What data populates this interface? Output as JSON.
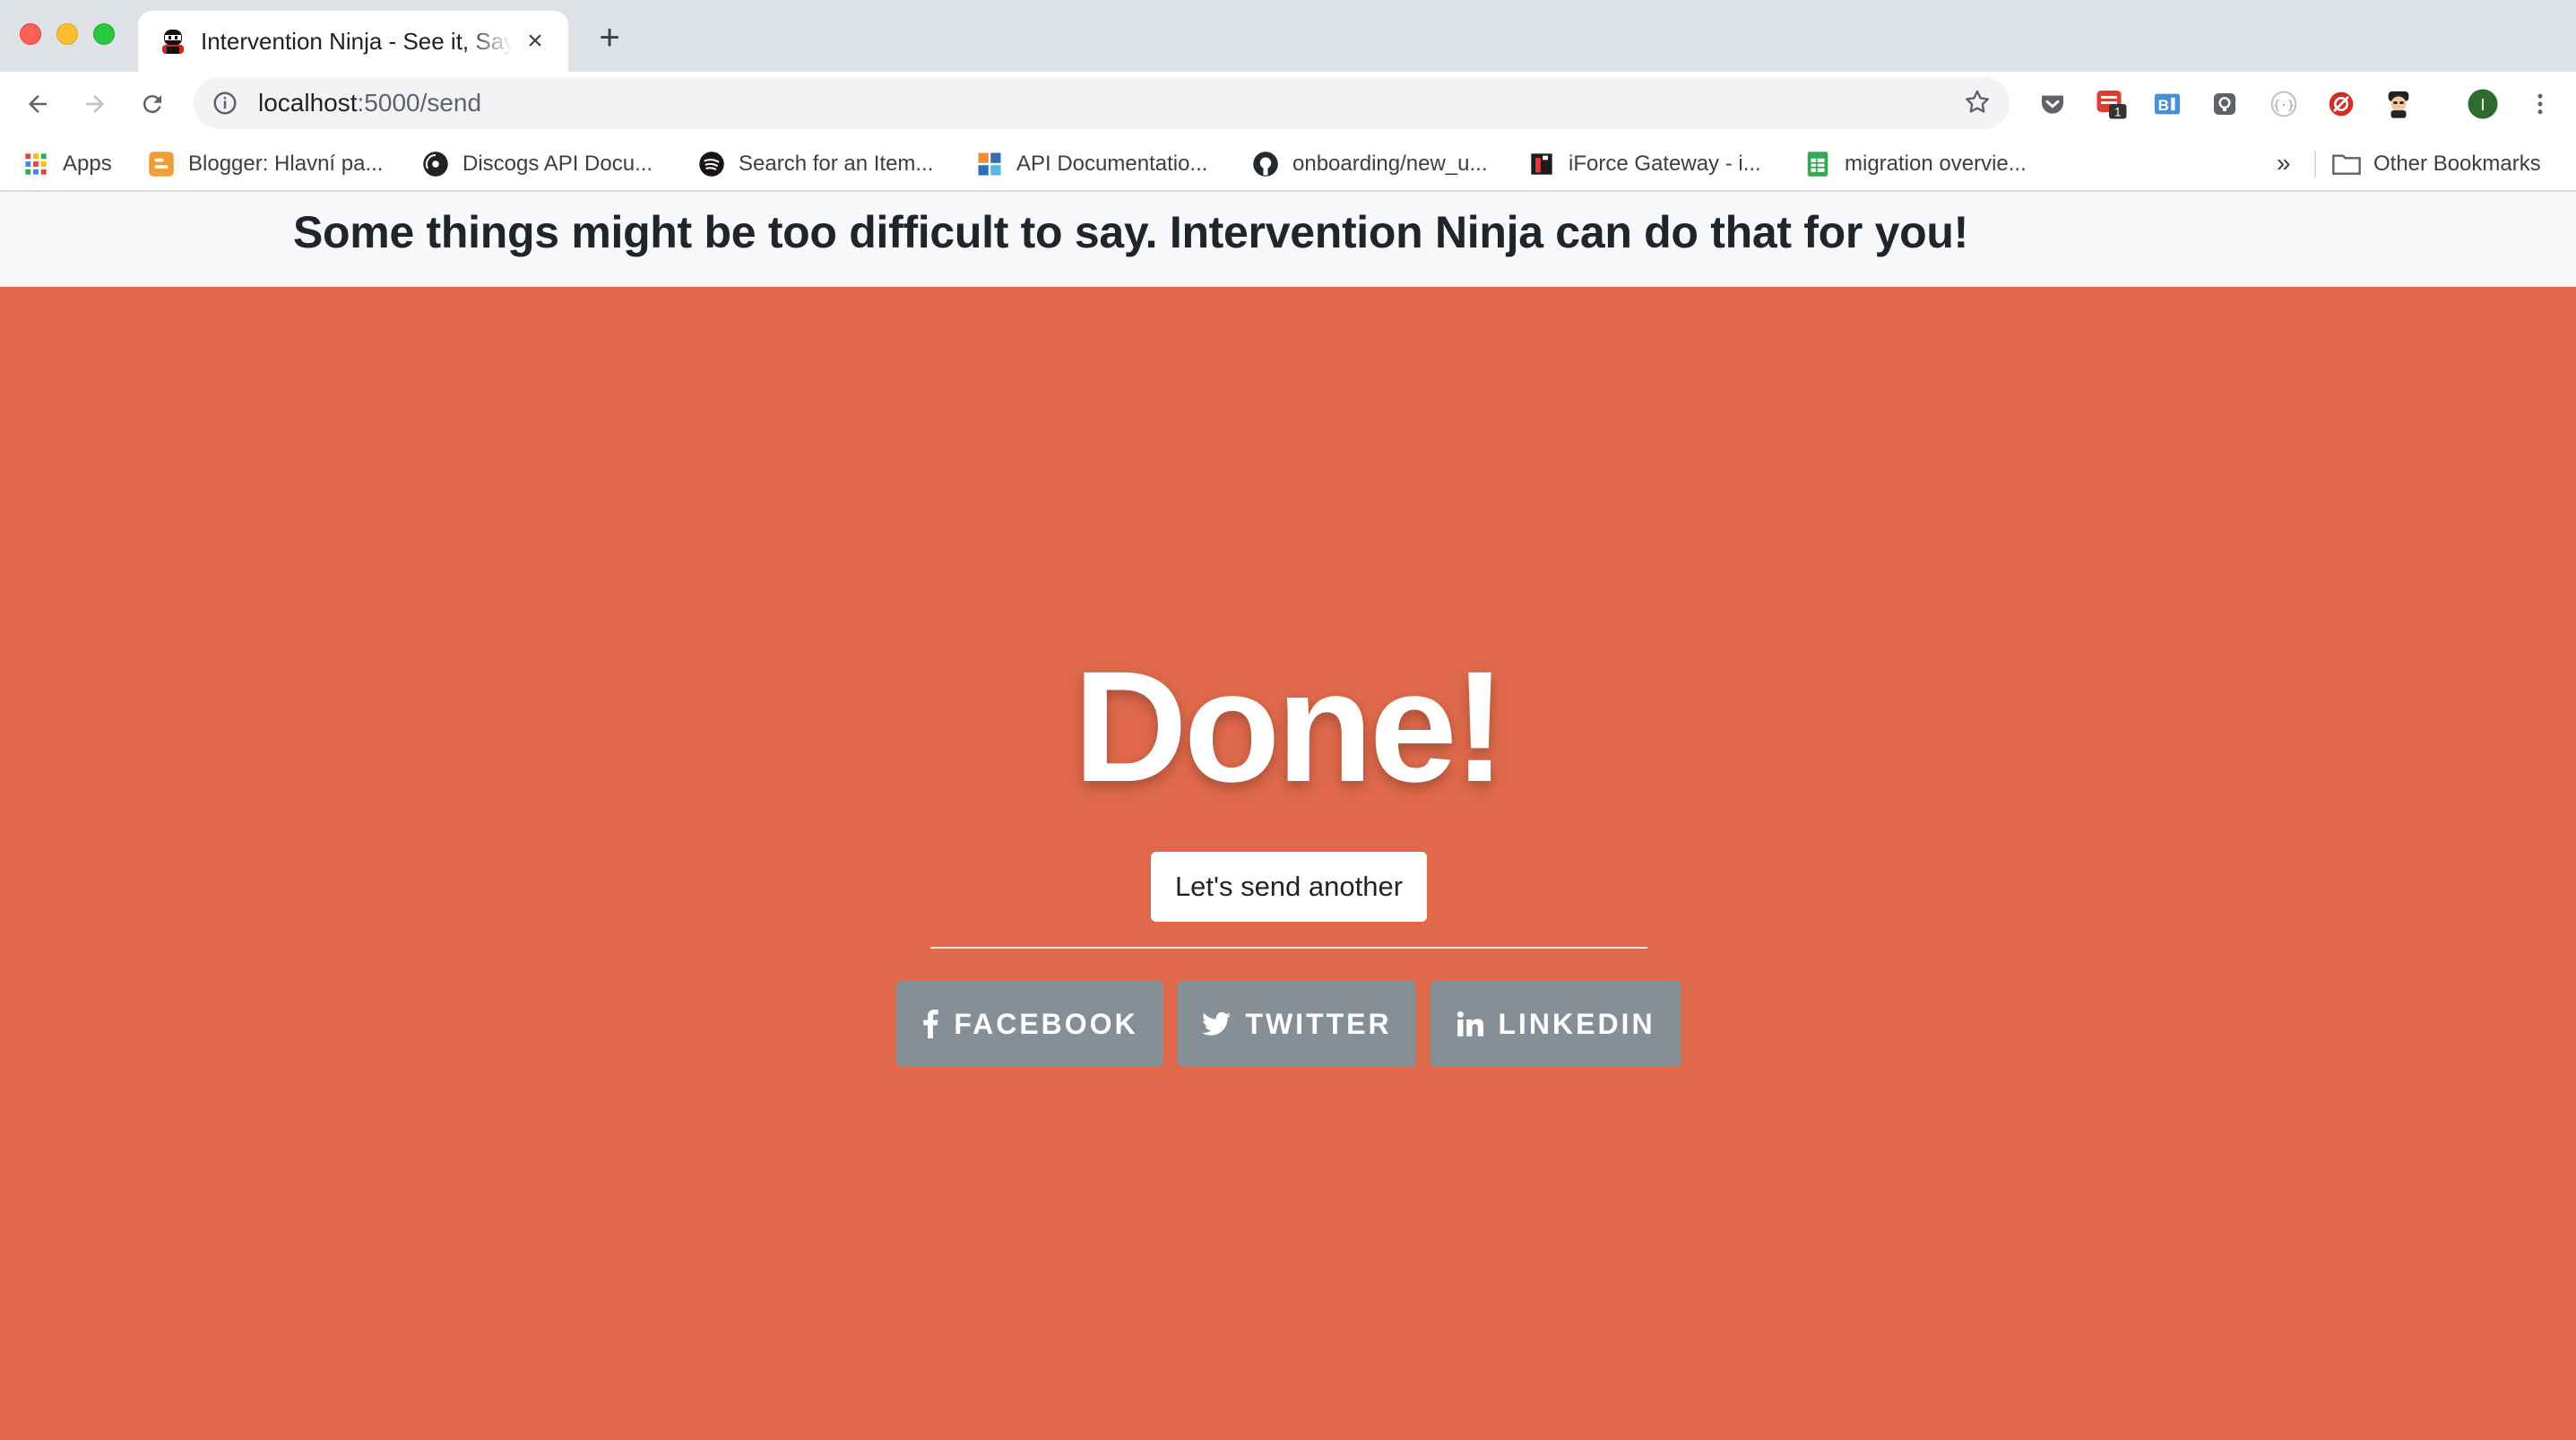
{
  "browser": {
    "tab": {
      "title": "Intervention Ninja - See it, Say it, Send it"
    },
    "address": {
      "host": "localhost",
      "path": ":5000/send"
    },
    "bookmarks": [
      {
        "label": "Apps",
        "icon": "apps-grid-icon"
      },
      {
        "label": "Blogger: Hlavní pa...",
        "icon": "blogger-icon"
      },
      {
        "label": "Discogs API Docu...",
        "icon": "discogs-icon"
      },
      {
        "label": "Search for an Item...",
        "icon": "spotify-icon"
      },
      {
        "label": "API Documentatio...",
        "icon": "api-doc-icon"
      },
      {
        "label": "onboarding/new_u...",
        "icon": "github-icon"
      },
      {
        "label": "iForce Gateway - i...",
        "icon": "iforce-icon"
      },
      {
        "label": "migration overvie...",
        "icon": "sheets-icon"
      }
    ],
    "other_bookmarks": "Other Bookmarks",
    "more_bookmarks": "»",
    "profile_initial": "I",
    "ext_badge": "1"
  },
  "page": {
    "tagline": "Some things might be too difficult to say. Intervention Ninja can do that for you!",
    "done_title": "Done!",
    "send_again_label": "Let's send another",
    "share": {
      "facebook": "FACEBOOK",
      "twitter": "TWITTER",
      "linkedin": "LINKEDIN"
    }
  },
  "colors": {
    "hero_bg": "#e0694b",
    "share_button_bg": "#868e96",
    "header_bg": "#f8f9fa"
  }
}
